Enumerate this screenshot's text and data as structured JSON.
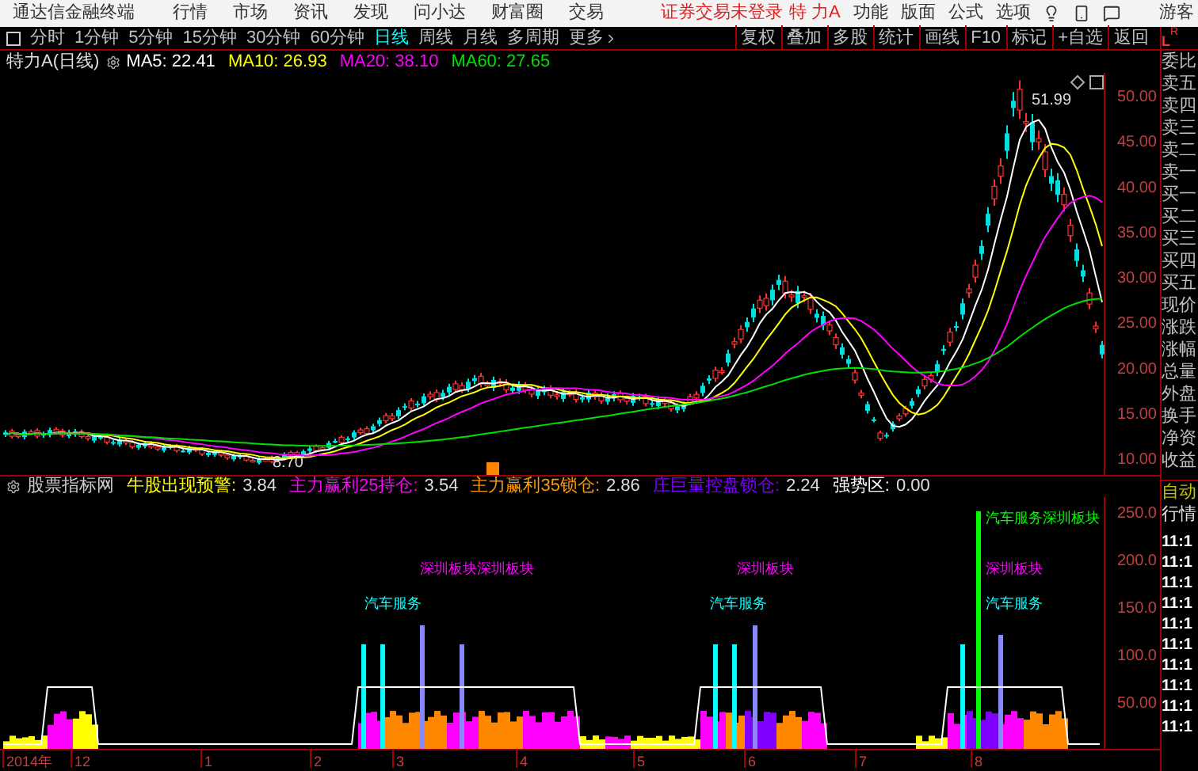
{
  "app": {
    "name": "通达信金融终端",
    "menus": [
      "行情",
      "市场",
      "资讯",
      "发现",
      "问小达",
      "财富圈",
      "交易"
    ],
    "login_notice": "证券交易未登录",
    "stock": "特 力A",
    "right_menus": [
      "功能",
      "版面",
      "公式",
      "选项"
    ],
    "user": "游客"
  },
  "toolbar": {
    "periods": [
      {
        "label": "分时",
        "selected": false
      },
      {
        "label": "1分钟",
        "selected": false
      },
      {
        "label": "5分钟",
        "selected": false
      },
      {
        "label": "15分钟",
        "selected": false
      },
      {
        "label": "30分钟",
        "selected": false
      },
      {
        "label": "60分钟",
        "selected": false
      },
      {
        "label": "日线",
        "selected": true
      },
      {
        "label": "周线",
        "selected": false
      },
      {
        "label": "月线",
        "selected": false
      },
      {
        "label": "多周期",
        "selected": false
      }
    ],
    "more": "更多",
    "actions": [
      "复权",
      "叠加",
      "多股",
      "统计",
      "画线",
      "F10",
      "标记",
      "+自选",
      "返回"
    ]
  },
  "main_chart": {
    "title": "特力A(日线)",
    "mas": [
      {
        "label": "MA5: 22.41",
        "color": "#ffffff"
      },
      {
        "label": "MA10: 26.93",
        "color": "#ffff00"
      },
      {
        "label": "MA20: 38.10",
        "color": "#ff00ff"
      },
      {
        "label": "MA60: 27.65",
        "color": "#00e000"
      }
    ],
    "high_label": "51.99",
    "low_label": "8.70",
    "y_axis": [
      "50.00",
      "45.00",
      "40.00",
      "35.00",
      "30.00",
      "25.00",
      "20.00",
      "15.00",
      "10.00"
    ]
  },
  "indicator": {
    "name": "股票指标网",
    "items": [
      {
        "label": "牛股出现预警:",
        "value": "3.84",
        "color": "#ffff00"
      },
      {
        "label": "主力赢利25持仓:",
        "value": "3.54",
        "color": "#ff00ff"
      },
      {
        "label": "主力赢利35锁仓:",
        "value": "2.86",
        "color": "#ff9900"
      },
      {
        "label": "庄巨量控盘锁仓:",
        "value": "2.24",
        "color": "#8000ff"
      },
      {
        "label": "强势区:",
        "value": "0.00",
        "color": "#ffffff"
      }
    ],
    "signals": [
      {
        "text": "深圳板块深圳板块",
        "color": "#ff00ff"
      },
      {
        "text": "汽车服务",
        "color": "#00ffff"
      },
      {
        "text": "深圳板块",
        "color": "#ff00ff"
      },
      {
        "text": "汽车服务",
        "color": "#00ffff"
      },
      {
        "text": "汽车服务深圳板块",
        "color": "#00ff00"
      },
      {
        "text": "深圳板块",
        "color": "#ff00ff"
      },
      {
        "text": "汽车服务",
        "color": "#00ffff"
      }
    ],
    "y_axis": [
      "250.0",
      "200.0",
      "150.0",
      "100.0",
      "50.00"
    ]
  },
  "x_axis": [
    "2014年",
    "12",
    "1",
    "2",
    "3",
    "4",
    "5",
    "6",
    "7",
    "8"
  ],
  "quote_panel": {
    "toggle_labels": [
      "L",
      "R"
    ],
    "fields": [
      "委比",
      "卖五",
      "卖四",
      "卖三",
      "卖二",
      "卖一",
      "买一",
      "买二",
      "买三",
      "买四",
      "买五",
      "现价",
      "涨跌",
      "涨幅",
      "总量",
      "外盘",
      "换手",
      "净资",
      "收益"
    ],
    "auto": "自动",
    "market": "行情",
    "times": [
      "11:1",
      "11:1",
      "11:1",
      "11:1",
      "11:1",
      "11:1",
      "11:1",
      "11:1",
      "11:1",
      "11:1"
    ]
  }
}
